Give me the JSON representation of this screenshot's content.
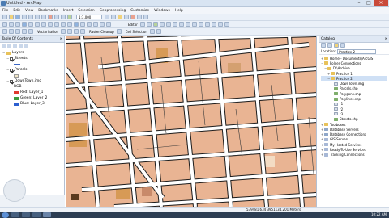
{
  "window": {
    "title": "Untitled - ArcMap"
  },
  "menu": [
    "File",
    "Edit",
    "View",
    "Bookmarks",
    "Insert",
    "Selection",
    "Geoprocessing",
    "Customize",
    "Windows",
    "Help"
  ],
  "toolbar": {
    "scale": "1:3,000",
    "editor_label": "Editor",
    "vectorization_label": "Vectorization",
    "raster_cleanup_label": "Raster Cleanup",
    "cell_selection_label": "Cell Selection"
  },
  "toc": {
    "title": "Table Of Contents",
    "layers_group": "Layers",
    "items": [
      {
        "name": "Streets",
        "checked": true
      },
      {
        "name": "Parcels",
        "checked": true
      },
      {
        "name": "DownTown.img",
        "checked": true
      }
    ],
    "raster_label": "RGB",
    "bands": [
      {
        "label": "Red: Layer_1",
        "color": "#e03a2f"
      },
      {
        "label": "Green: Layer_2",
        "color": "#3c9a3c"
      },
      {
        "label": "Blue: Layer_3",
        "color": "#2c5fd0"
      }
    ]
  },
  "catalog": {
    "title": "Catalog",
    "location_label": "Location:",
    "location_value": "Practice 2",
    "items": [
      {
        "label": "Home - Documents\\ArcGIS",
        "indent": 0,
        "icon": "fold"
      },
      {
        "label": "Folder Connections",
        "indent": 0,
        "icon": "fold"
      },
      {
        "label": "D:\\Archive",
        "indent": 1,
        "icon": "fold"
      },
      {
        "label": "Practice 1",
        "indent": 2,
        "icon": "fold"
      },
      {
        "label": "Practice 2",
        "indent": 2,
        "icon": "fold"
      },
      {
        "label": "DownTown.img",
        "indent": 3,
        "icon": "doc"
      },
      {
        "label": "Parcels.shp",
        "indent": 3,
        "icon": "shp"
      },
      {
        "label": "Polygons.shp",
        "indent": 3,
        "icon": "shp"
      },
      {
        "label": "Polylines.shp",
        "indent": 3,
        "icon": "shp"
      },
      {
        "label": "r1",
        "indent": 3,
        "icon": "doc"
      },
      {
        "label": "r2",
        "indent": 3,
        "icon": "doc"
      },
      {
        "label": "r3",
        "indent": 3,
        "icon": "doc"
      },
      {
        "label": "Streets.shp",
        "indent": 3,
        "icon": "shp"
      },
      {
        "label": "Toolboxes",
        "indent": 0,
        "icon": "fold"
      },
      {
        "label": "Database Servers",
        "indent": 0,
        "icon": "db"
      },
      {
        "label": "Database Connections",
        "indent": 0,
        "icon": "db"
      },
      {
        "label": "GIS Servers",
        "indent": 0,
        "icon": "srv"
      },
      {
        "label": "My Hosted Services",
        "indent": 0,
        "icon": "srv"
      },
      {
        "label": "Ready-To-Use Services",
        "indent": 0,
        "icon": "srv"
      },
      {
        "label": "Tracking Connections",
        "indent": 0,
        "icon": "srv"
      }
    ]
  },
  "status": {
    "coordinates": "539481.634  3951134.201 Meters"
  },
  "taskbar": {
    "time": "10:22 AM"
  },
  "colors": {
    "parcel": "#e9b493",
    "street": "#ffffff",
    "street_outline": "#1c1c1c",
    "highlight": "#d79a56"
  }
}
